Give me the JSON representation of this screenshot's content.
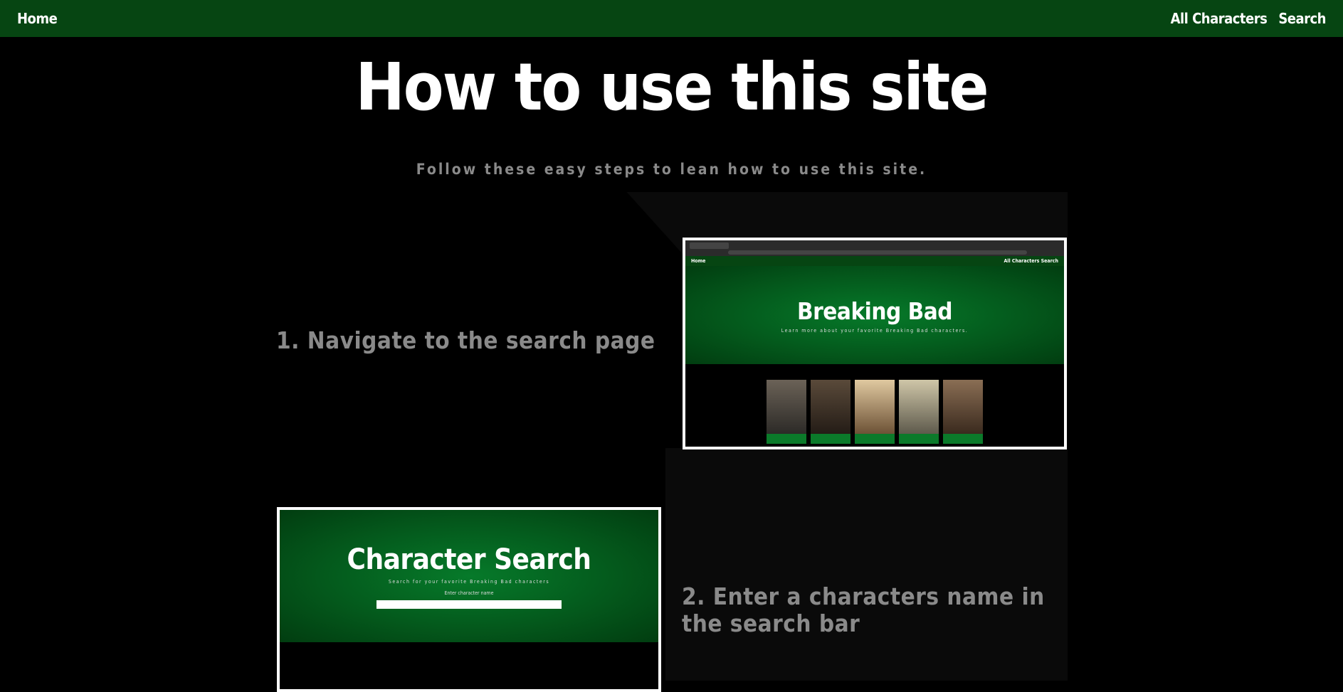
{
  "nav": {
    "home": "Home",
    "all_characters": "All Characters",
    "search": "Search"
  },
  "header": {
    "title": "How to use this site",
    "subtitle": "Follow these easy steps to lean how to use this site."
  },
  "steps": [
    {
      "text": "1. Navigate to the search page",
      "screenshot": {
        "nav_home": "Home",
        "nav_right": "All Characters  Search",
        "hero_title": "Breaking Bad",
        "hero_subtitle": "Learn more about your favorite Breaking Bad characters."
      }
    },
    {
      "text": "2. Enter a characters name in the search bar",
      "screenshot": {
        "hero_title": "Character Search",
        "hero_subtitle": "Search for your favorite Breaking Bad characters",
        "search_label": "Enter character name"
      }
    }
  ],
  "colors": {
    "nav_bg": "#064512",
    "accent_green": "#0b7a2a",
    "muted_text": "#8a8a8a"
  }
}
